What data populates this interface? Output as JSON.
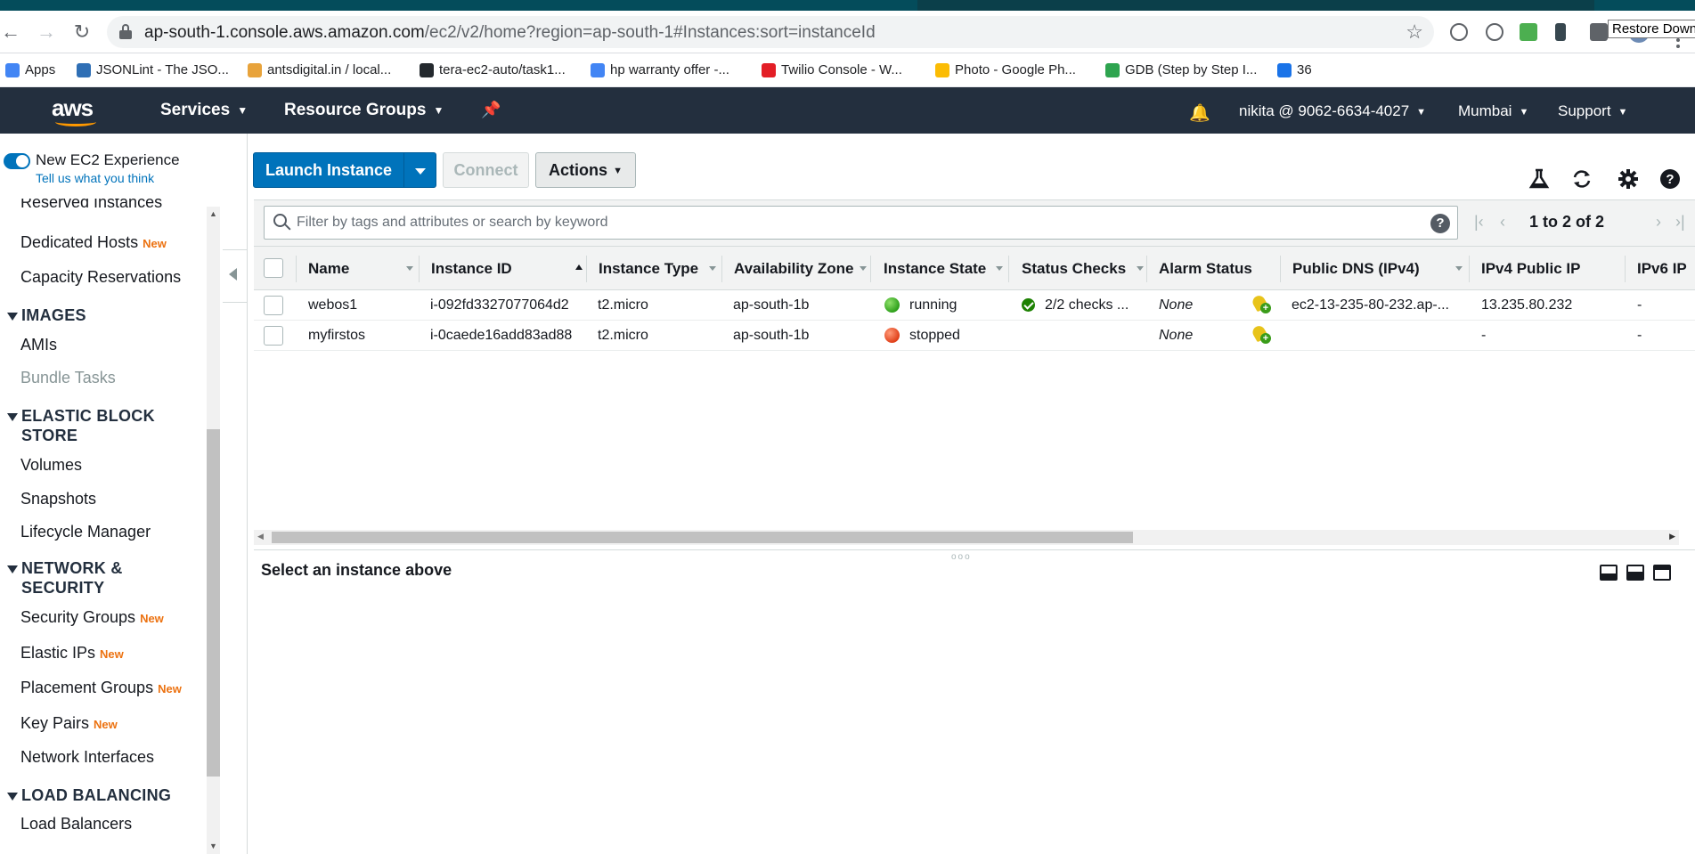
{
  "browser": {
    "url_host": "ap-south-1.console.aws.amazon.com",
    "url_path": "/ec2/v2/home?region=ap-south-1#Instances:sort=instanceId",
    "tooltip": "Restore Down",
    "bookmarks": [
      {
        "label": "Apps",
        "color": "#4285f4"
      },
      {
        "label": "JSONLint - The JSO...",
        "color": "#2f6fb5"
      },
      {
        "label": "antsdigital.in / local...",
        "color": "#e8a33b"
      },
      {
        "label": "tera-ec2-auto/task1...",
        "color": "#24292e"
      },
      {
        "label": "hp warranty offer -...",
        "color": "#4285f4"
      },
      {
        "label": "Twilio Console - W...",
        "color": "#e31e26"
      },
      {
        "label": "Photo - Google Ph...",
        "color": "#fbbc04"
      },
      {
        "label": "GDB (Step by Step I...",
        "color": "#2ea44f"
      },
      {
        "label": "36",
        "color": "#1a73e8"
      }
    ]
  },
  "nav": {
    "services": "Services",
    "resource_groups": "Resource Groups",
    "account": "nikita @ 9062-6634-4027",
    "region": "Mumbai",
    "support": "Support"
  },
  "sidebar": {
    "toggle_label": "New EC2 Experience",
    "toggle_link": "Tell us what you think",
    "reserved": "Reserved Instances",
    "dedicated_hosts": "Dedicated Hosts",
    "new_badge": "New",
    "capacity": "Capacity Reservations",
    "images_head": "IMAGES",
    "amis": "AMIs",
    "bundle_tasks": "Bundle Tasks",
    "ebs_head_1": "ELASTIC BLOCK",
    "ebs_head_2": "STORE",
    "volumes": "Volumes",
    "snapshots": "Snapshots",
    "lifecycle": "Lifecycle Manager",
    "net_head_1": "NETWORK &",
    "net_head_2": "SECURITY",
    "security_groups": "Security Groups",
    "elastic_ips": "Elastic IPs",
    "placement_groups": "Placement Groups",
    "key_pairs": "Key Pairs",
    "network_interfaces": "Network Interfaces",
    "lb_head": "LOAD BALANCING",
    "load_balancers": "Load Balancers"
  },
  "toolbar": {
    "launch": "Launch Instance",
    "connect": "Connect",
    "actions": "Actions"
  },
  "filter": {
    "placeholder": "Filter by tags and attributes or search by keyword",
    "help": "?",
    "pagination": "1 to 2 of 2"
  },
  "table": {
    "columns": [
      "Name",
      "Instance ID",
      "Instance Type",
      "Availability Zone",
      "Instance State",
      "Status Checks",
      "Alarm Status",
      "Public DNS (IPv4)",
      "IPv4 Public IP",
      "IPv6 IP"
    ],
    "rows": [
      {
        "name": "webos1",
        "id": "i-092fd3327077064d2",
        "type": "t2.micro",
        "az": "ap-south-1b",
        "state": "running",
        "state_color": "green",
        "checks": "2/2 checks ...",
        "alarm": "None",
        "dns": "ec2-13-235-80-232.ap-...",
        "ipv4": "13.235.80.232",
        "ipv6": "-"
      },
      {
        "name": "myfirstos",
        "id": "i-0caede16add83ad88",
        "type": "t2.micro",
        "az": "ap-south-1b",
        "state": "stopped",
        "state_color": "red",
        "checks": "",
        "alarm": "None",
        "dns": "",
        "ipv4": "-",
        "ipv6": "-"
      }
    ]
  },
  "detail": {
    "title": "Select an instance above"
  }
}
